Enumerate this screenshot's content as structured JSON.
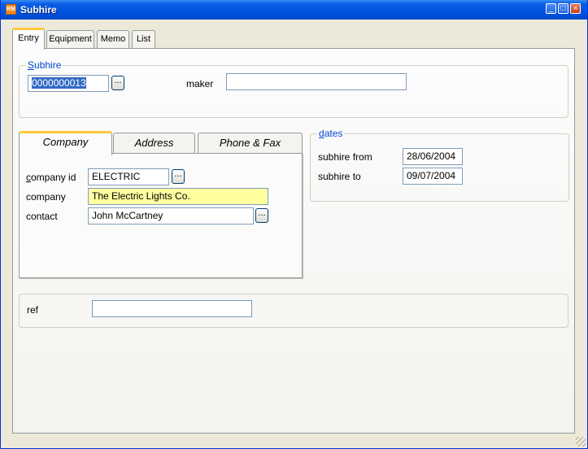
{
  "window": {
    "title": "Subhire",
    "icon": "app-icon"
  },
  "tabs": [
    {
      "label": "Entry",
      "active": true
    },
    {
      "label": "Equipment",
      "active": false
    },
    {
      "label": "Memo",
      "active": false
    },
    {
      "label": "List",
      "active": false
    }
  ],
  "subhire_group": {
    "legend_first": "S",
    "legend_rest": "ubhire",
    "id_value": "0000000013",
    "lookup_label": "...",
    "maker_label": "maker",
    "maker_value": ""
  },
  "sub_tabs": [
    {
      "label": "Company",
      "active": true
    },
    {
      "label": "Address",
      "active": false
    },
    {
      "label": "Phone & Fax",
      "active": false
    }
  ],
  "company_panel": {
    "company_id_label_first": "c",
    "company_id_label_rest": "ompany id",
    "company_id_value": "ELECTRIC",
    "company_label": "company",
    "company_value": "The Electric Lights Co.",
    "contact_label": "contact",
    "contact_value": "John McCartney",
    "lookup_label": "..."
  },
  "dates_group": {
    "legend_first": "d",
    "legend_rest": "ates",
    "from_label": "subhire from",
    "from_value": "28/06/2004",
    "to_label": "subhire to",
    "to_value": "09/07/2004"
  },
  "ref_group": {
    "ref_label": "ref",
    "ref_value": ""
  },
  "colors": {
    "accent": "#0046d5",
    "tab_highlight": "#ffc83c",
    "highlight_field": "#ffffa0"
  }
}
